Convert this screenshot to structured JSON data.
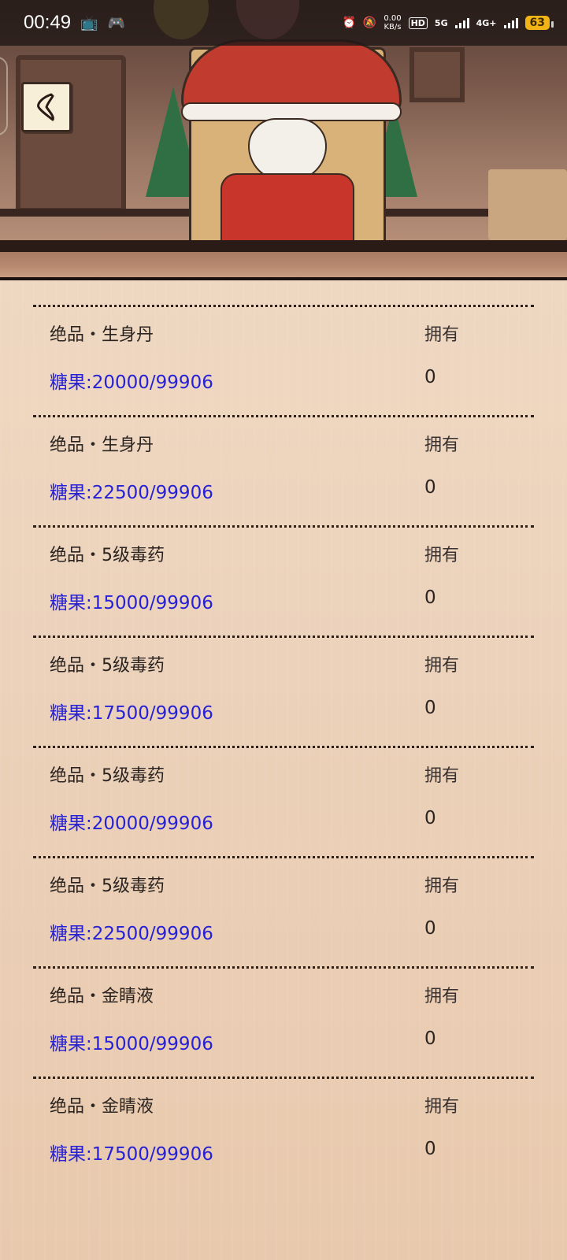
{
  "status_bar": {
    "time": "00:49",
    "net_speed": "0.00",
    "net_unit": "KB/s",
    "hd_label": "HD",
    "sim1_label": "5G",
    "sim2_label": "4G+",
    "battery": "63"
  },
  "header": {
    "back_icon": "chevron-left-icon"
  },
  "items": [
    {
      "name": "绝品・生身丹",
      "price": "糖果:20000/99906",
      "own_label": "拥有",
      "own_value": "0"
    },
    {
      "name": "绝品・生身丹",
      "price": "糖果:22500/99906",
      "own_label": "拥有",
      "own_value": "0"
    },
    {
      "name": "绝品・5级毒药",
      "price": "糖果:15000/99906",
      "own_label": "拥有",
      "own_value": "0"
    },
    {
      "name": "绝品・5级毒药",
      "price": "糖果:17500/99906",
      "own_label": "拥有",
      "own_value": "0"
    },
    {
      "name": "绝品・5级毒药",
      "price": "糖果:20000/99906",
      "own_label": "拥有",
      "own_value": "0"
    },
    {
      "name": "绝品・5级毒药",
      "price": "糖果:22500/99906",
      "own_label": "拥有",
      "own_value": "0"
    },
    {
      "name": "绝品・金睛液",
      "price": "糖果:15000/99906",
      "own_label": "拥有",
      "own_value": "0"
    },
    {
      "name": "绝品・金睛液",
      "price": "糖果:17500/99906",
      "own_label": "拥有",
      "own_value": "0"
    }
  ],
  "colors": {
    "price_text": "#2621d6",
    "background": "#e9cdb3",
    "battery": "#f2b316"
  }
}
